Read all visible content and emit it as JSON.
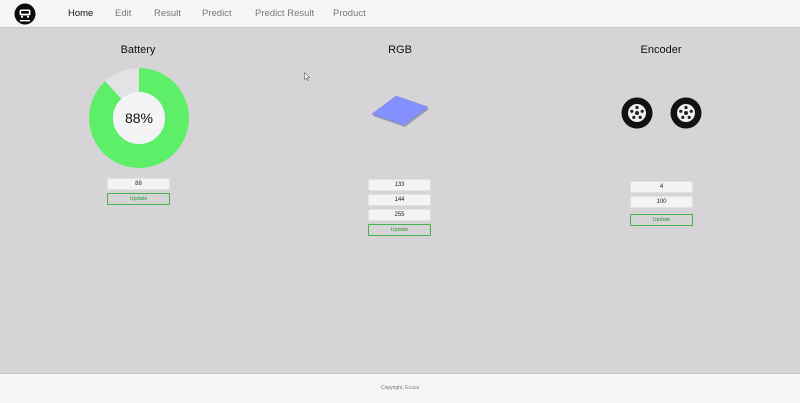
{
  "nav": {
    "logo_icon": "car-icon",
    "items": [
      {
        "label": "Home",
        "active": true
      },
      {
        "label": "Edit",
        "active": false
      },
      {
        "label": "Result",
        "active": false
      },
      {
        "label": "Predict",
        "active": false
      },
      {
        "label": "Predict Result",
        "active": false
      },
      {
        "label": "Product",
        "active": false
      }
    ]
  },
  "battery": {
    "title": "Battery",
    "level_percent": 88,
    "level_label": "88%",
    "input_value": "88",
    "update_label": "Update",
    "fill_color": "#5eef68",
    "track_color": "#e3e3e5"
  },
  "rgb": {
    "title": "RGB",
    "r": "133",
    "g": "144",
    "b": "255",
    "swatch_color": "#8590ff",
    "update_label": "Update"
  },
  "encoder": {
    "title": "Encoder",
    "wheel_icon": "wheel-icon",
    "left_value": "4",
    "right_value": "100",
    "update_label": "Update"
  },
  "footer": {
    "text": "Copyright, Ecuca"
  },
  "colors": {
    "accent_green": "#43b34a",
    "background": "#d6d4d6",
    "bar_background": "#f6f6f8"
  }
}
